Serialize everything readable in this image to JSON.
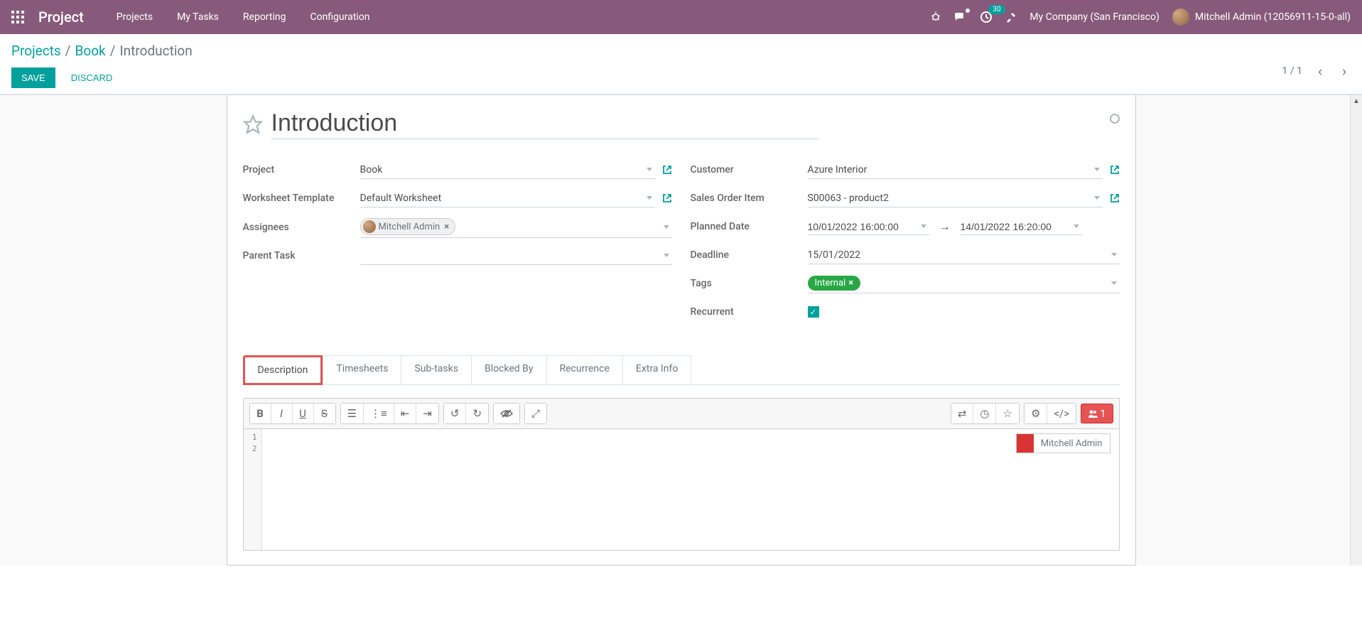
{
  "brand": "Project",
  "nav": {
    "projects": "Projects",
    "my_tasks": "My Tasks",
    "reporting": "Reporting",
    "configuration": "Configuration"
  },
  "header": {
    "badge_count": "30",
    "company": "My Company (San Francisco)",
    "user": "Mitchell Admin (12056911-15-0-all)"
  },
  "breadcrumb": {
    "root": "Projects",
    "project": "Book",
    "current": "Introduction"
  },
  "buttons": {
    "save": "SAVE",
    "discard": "DISCARD"
  },
  "pager": {
    "text": "1 / 1"
  },
  "task": {
    "title": "Introduction",
    "labels": {
      "project": "Project",
      "worksheet": "Worksheet Template",
      "assignees": "Assignees",
      "parent": "Parent Task",
      "customer": "Customer",
      "sales_order": "Sales Order Item",
      "planned": "Planned Date",
      "deadline": "Deadline",
      "tags": "Tags",
      "recurrent": "Recurrent"
    },
    "project": "Book",
    "worksheet": "Default Worksheet",
    "assignee": "Mitchell Admin",
    "customer": "Azure Interior",
    "sales_order": "S00063 - product2",
    "planned_start": "10/01/2022 16:00:00",
    "planned_end": "14/01/2022 16:20:00",
    "deadline": "15/01/2022",
    "tag": "Internal"
  },
  "tabs": {
    "description": "Description",
    "timesheets": "Timesheets",
    "subtasks": "Sub-tasks",
    "blocked": "Blocked By",
    "recurrence": "Recurrence",
    "extra": "Extra Info"
  },
  "collab": {
    "user": "Mitchell Admin",
    "count": "1"
  },
  "lines": [
    "1",
    "2"
  ]
}
